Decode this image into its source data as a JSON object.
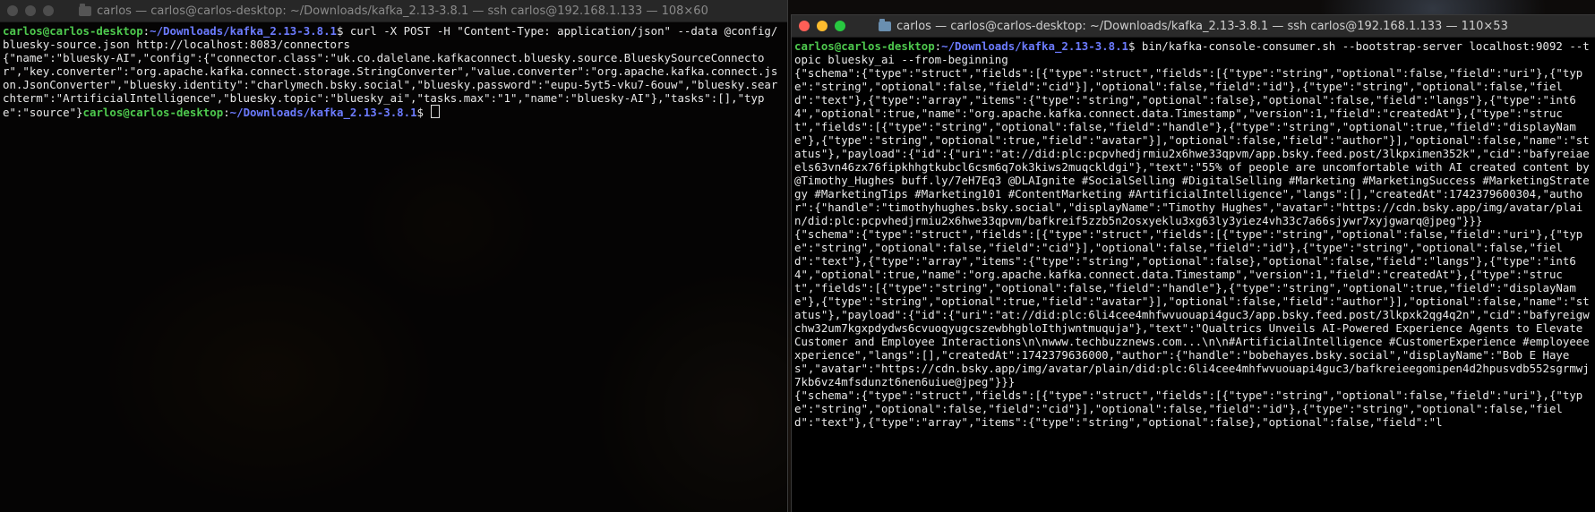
{
  "left_window": {
    "title": "carlos — carlos@carlos-desktop: ~/Downloads/kafka_2.13-3.8.1 — ssh carlos@192.168.1.133 — 108×60",
    "prompt_user": "carlos@carlos-desktop",
    "prompt_path": "~/Downloads/kafka_2.13-3.8.1",
    "command": "$ curl -X POST -H \"Content-Type: application/json\" --data @config/bluesky-source.json http://localhost:8083/connectors",
    "output": "{\"name\":\"bluesky-AI\",\"config\":{\"connector.class\":\"uk.co.dalelane.kafkaconnect.bluesky.source.BlueskySourceConnector\",\"key.converter\":\"org.apache.kafka.connect.storage.StringConverter\",\"value.converter\":\"org.apache.kafka.connect.json.JsonConverter\",\"bluesky.identity\":\"charlymech.bsky.social\",\"bluesky.password\":\"eupu-5yt5-vku7-6ouw\",\"bluesky.searchterm\":\"ArtificialIntelligence\",\"bluesky.topic\":\"bluesky_ai\",\"tasks.max\":\"1\",\"name\":\"bluesky-AI\"},\"tasks\":[],\"type\":\"source\"}",
    "prompt2_user": "carlos@carlos-desktop",
    "prompt2_path": "~/Downloads/kafka_2.13-3.8.1",
    "prompt2_suffix": "$ "
  },
  "right_window": {
    "title": "carlos — carlos@carlos-desktop: ~/Downloads/kafka_2.13-3.8.1 — ssh carlos@192.168.1.133 — 110×53",
    "prompt_user": "carlos@carlos-desktop",
    "prompt_path": "~/Downloads/kafka_2.13-3.8.1",
    "command": "$ bin/kafka-console-consumer.sh --bootstrap-server localhost:9092 --topic bluesky_ai --from-beginning",
    "records": [
      "{\"schema\":{\"type\":\"struct\",\"fields\":[{\"type\":\"struct\",\"fields\":[{\"type\":\"string\",\"optional\":false,\"field\":\"uri\"},{\"type\":\"string\",\"optional\":false,\"field\":\"cid\"}],\"optional\":false,\"field\":\"id\"},{\"type\":\"string\",\"optional\":false,\"field\":\"text\"},{\"type\":\"array\",\"items\":{\"type\":\"string\",\"optional\":false},\"optional\":false,\"field\":\"langs\"},{\"type\":\"int64\",\"optional\":true,\"name\":\"org.apache.kafka.connect.data.Timestamp\",\"version\":1,\"field\":\"createdAt\"},{\"type\":\"struct\",\"fields\":[{\"type\":\"string\",\"optional\":false,\"field\":\"handle\"},{\"type\":\"string\",\"optional\":true,\"field\":\"displayName\"},{\"type\":\"string\",\"optional\":true,\"field\":\"avatar\"}],\"optional\":false,\"field\":\"author\"}],\"optional\":false,\"name\":\"status\"},\"payload\":{\"id\":{\"uri\":\"at://did:plc:pcpvhedjrmiu2x6hwe33qpvm/app.bsky.feed.post/3lkpximen352k\",\"cid\":\"bafyreiaeels63vn46zx76fipkhhgtkubcl6csm6q7ok3kiws2muqckldgi\"},\"text\":\"55% of people are uncomfortable with AI created content by @Timothy_Hughes buff.ly/7eH7Eq3 @DLAIgnite #SocialSelling #DigitalSelling #Marketing #MarketingSuccess #MarketingStrategy #MarketingTips #Marketing101 #ContentMarketing #ArtificialIntelligence\",\"langs\":[],\"createdAt\":1742379600304,\"author\":{\"handle\":\"timothyhughes.bsky.social\",\"displayName\":\"Timothy Hughes\",\"avatar\":\"https://cdn.bsky.app/img/avatar/plain/did:plc:pcpvhedjrmiu2x6hwe33qpvm/bafkreif5zzb5n2osxyeklu3xg63ly3yiez4vh33c7a66sjywr7xyjgwarq@jpeg\"}}}",
      "{\"schema\":{\"type\":\"struct\",\"fields\":[{\"type\":\"struct\",\"fields\":[{\"type\":\"string\",\"optional\":false,\"field\":\"uri\"},{\"type\":\"string\",\"optional\":false,\"field\":\"cid\"}],\"optional\":false,\"field\":\"id\"},{\"type\":\"string\",\"optional\":false,\"field\":\"text\"},{\"type\":\"array\",\"items\":{\"type\":\"string\",\"optional\":false},\"optional\":false,\"field\":\"langs\"},{\"type\":\"int64\",\"optional\":true,\"name\":\"org.apache.kafka.connect.data.Timestamp\",\"version\":1,\"field\":\"createdAt\"},{\"type\":\"struct\",\"fields\":[{\"type\":\"string\",\"optional\":false,\"field\":\"handle\"},{\"type\":\"string\",\"optional\":true,\"field\":\"displayName\"},{\"type\":\"string\",\"optional\":true,\"field\":\"avatar\"}],\"optional\":false,\"field\":\"author\"}],\"optional\":false,\"name\":\"status\"},\"payload\":{\"id\":{\"uri\":\"at://did:plc:6li4cee4mhfwvuouapi4guc3/app.bsky.feed.post/3lkpxk2qg4q2n\",\"cid\":\"bafyreigwchw32um7kgxpdydws6cvuoqyugcszewbhgbloIthjwntmuquja\"},\"text\":\"Qualtrics Unveils AI-Powered Experience Agents to Elevate Customer and Employee Interactions\\n\\nwww.techbuzznews.com...\\n\\n#ArtificialIntelligence #CustomerExperience #employeeexperience\",\"langs\":[],\"createdAt\":1742379636000,\"author\":{\"handle\":\"bobehayes.bsky.social\",\"displayName\":\"Bob E Hayes\",\"avatar\":\"https://cdn.bsky.app/img/avatar/plain/did:plc:6li4cee4mhfwvuouapi4guc3/bafkreieegomipen4d2hpusvdb552sgrmwj7kb6vz4mfsdunzt6nen6uiue@jpeg\"}}}",
      "{\"schema\":{\"type\":\"struct\",\"fields\":[{\"type\":\"struct\",\"fields\":[{\"type\":\"string\",\"optional\":false,\"field\":\"uri\"},{\"type\":\"string\",\"optional\":false,\"field\":\"cid\"}],\"optional\":false,\"field\":\"id\"},{\"type\":\"string\",\"optional\":false,\"field\":\"text\"},{\"type\":\"array\",\"items\":{\"type\":\"string\",\"optional\":false},\"optional\":false,\"field\":\"l"
    ]
  },
  "colors": {
    "prompt_user": "#4ec94e",
    "prompt_path": "#6c7bff",
    "text": "#e8e8e8"
  },
  "icons": [
    "folder-icon",
    "close-light",
    "minimize-light",
    "zoom-light",
    "cursor-block"
  ]
}
